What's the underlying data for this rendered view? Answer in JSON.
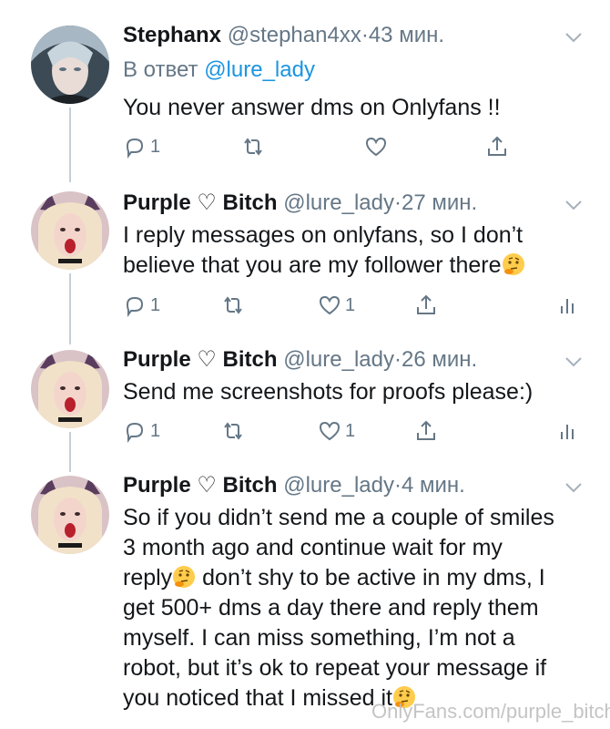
{
  "tweets": [
    {
      "name": "Stephanx",
      "handle": "@stephan4xx",
      "sep": "·",
      "time": "43 мин.",
      "reply_prefix": "В ответ",
      "reply_mention": "@lure_lady",
      "text": "You never answer dms on Onlyfans !!",
      "reply_count": "1",
      "retweet_count": "",
      "like_count": "",
      "avatar_icon": "avatar-stephanx"
    },
    {
      "name": "Purple ♡ Bitch",
      "handle": "@lure_lady",
      "sep": "·",
      "time": "27 мин.",
      "text_lines": [
        "I reply messages on onlyfans, so I don’t",
        "believe that you are my follower there"
      ],
      "reply_count": "1",
      "like_count": "1",
      "avatar_icon": "avatar-purple-bitch"
    },
    {
      "name": "Purple ♡ Bitch",
      "handle": "@lure_lady",
      "sep": "·",
      "time": "26 мин.",
      "text": "Send me screenshots for proofs please:)",
      "reply_count": "1",
      "like_count": "1",
      "avatar_icon": "avatar-purple-bitch"
    },
    {
      "name": "Purple ♡ Bitch",
      "handle": "@lure_lady",
      "sep": "·",
      "time": "4 мин.",
      "text_lines": [
        "So if you didn’t send me a couple of smiles",
        "3 month ago and continue wait for my",
        "reply",
        " don’t shy to be active in my dms, I",
        "get 500+ dms a day there and reply them",
        "myself. I can miss something, I’m not a",
        "robot, but it’s ok to repeat your message if",
        "you noticed that I missed it"
      ],
      "avatar_icon": "avatar-purple-bitch"
    }
  ],
  "watermark": "OnlyFans.com/purple_bitch",
  "colors": {
    "text": "#14171a",
    "secondary": "#657786",
    "link": "#1b95e0",
    "thread_line": "#c4cfd6"
  }
}
